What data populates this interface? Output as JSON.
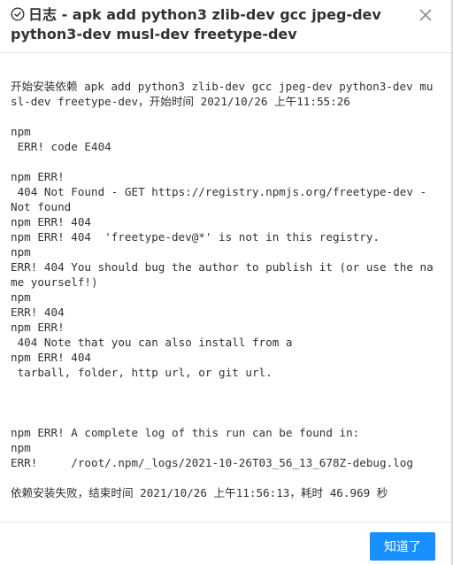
{
  "dialog": {
    "title": "日志 - apk add python3 zlib-dev gcc jpeg-dev python3-dev musl-dev freetype-dev",
    "title_icon": "check-circle-icon",
    "close_icon": "close-icon",
    "ok_label": "知道了",
    "accent_color": "#1890ff"
  },
  "log": {
    "lines": [
      "开始安装依赖 apk add python3 zlib-dev gcc jpeg-dev python3-dev musl-dev freetype-dev，开始时间 2021/10/26 上午11:55:26",
      "",
      "npm",
      " ERR! code E404",
      "",
      "npm ERR!",
      " 404 Not Found - GET https://registry.npmjs.org/freetype-dev - Not found",
      "npm ERR! 404",
      "npm ERR! 404  'freetype-dev@*' is not in this registry.",
      "npm",
      "ERR! 404 You should bug the author to publish it (or use the name yourself!)",
      "npm",
      "ERR! 404",
      "npm ERR!",
      " 404 Note that you can also install from a",
      "npm ERR! 404",
      " tarball, folder, http url, or git url.",
      "",
      "",
      "",
      "npm ERR! A complete log of this run can be found in:",
      "npm",
      "ERR!     /root/.npm/_logs/2021-10-26T03_56_13_678Z-debug.log",
      "",
      "依赖安装失败，结束时间 2021/10/26 上午11:56:13，耗时 46.969 秒"
    ]
  }
}
